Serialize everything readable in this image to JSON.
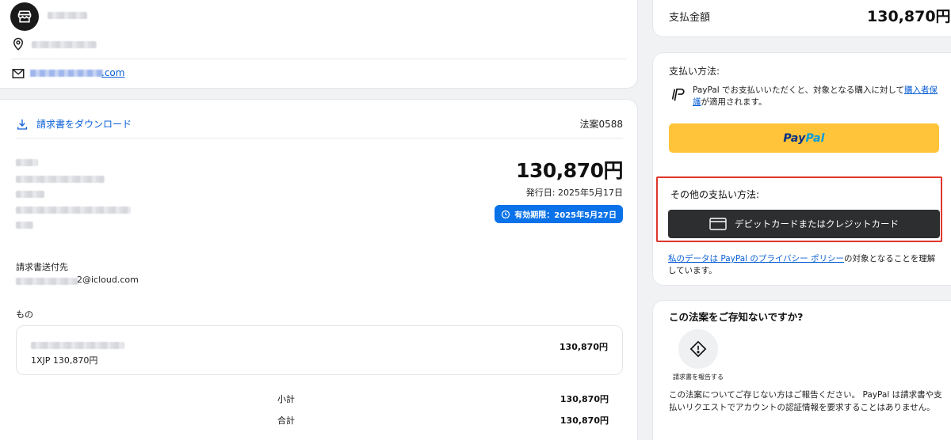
{
  "merchant": {
    "email_suffix": ".com"
  },
  "invoice": {
    "download_label": "請求書をダウンロード",
    "number": "法案0588",
    "amount": "130,870円",
    "issued": "発行日: 2025年5月17日",
    "due": "有効期限：2025年5月27日",
    "send_to_label": "請求書送付先",
    "send_to_email_visible": "2@icloud.com",
    "items_label": "もの",
    "item": {
      "qty_price": "1XJP 130,870円",
      "price": "130,870円"
    },
    "subtotal_label": "小計",
    "subtotal": "130,870円",
    "total_label": "合計",
    "total": "130,870円"
  },
  "payment_total": {
    "label": "支払金額",
    "amount": "130,870円"
  },
  "payment_method": {
    "title": "支払い方法:",
    "paypal_text_1": "PayPal でお支払いいただくと、対象となる購入に対して",
    "paypal_link": "購入者保護",
    "paypal_text_2": "が適用されます。",
    "paypal_button_pay": "Pay",
    "paypal_button_pal": "Pal"
  },
  "other_methods": {
    "title": "その他の支払い方法:",
    "card_button": "デビットカードまたはクレジットカード"
  },
  "privacy": {
    "link": "私のデータは PayPal のプライバシー ポリシー",
    "text": "の対象となることを理解しています。"
  },
  "unknown": {
    "title": "この法案をご存知ないですか?",
    "report_label": "請求書を報告する",
    "text": "この法案についてご存じない方はご報告ください。 PayPal は請求書や支払いリクエストでアカウントの認証情報を要求することはありません。"
  },
  "colors": {
    "accent_blue": "#0a5fd7",
    "badge_blue": "#0a72e8",
    "paypal_yellow": "#ffc439",
    "card_button": "#2c2e2f",
    "highlight_red": "#e0362b"
  }
}
